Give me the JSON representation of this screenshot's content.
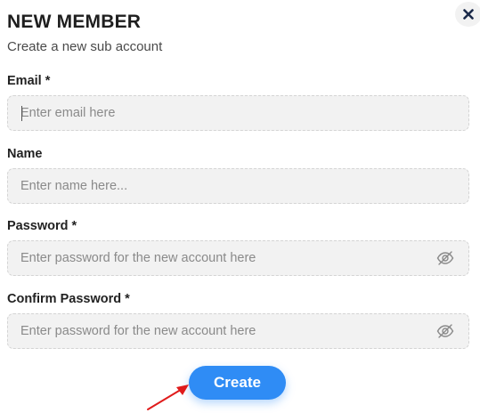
{
  "dialog": {
    "title": "NEW MEMBER",
    "subtitle": "Create a new sub account",
    "close_icon": "close-icon"
  },
  "form": {
    "email": {
      "label": "Email *",
      "placeholder": "Enter email here",
      "value": ""
    },
    "name": {
      "label": "Name",
      "placeholder": "Enter name here...",
      "value": ""
    },
    "password": {
      "label": "Password *",
      "placeholder": "Enter password for the new account here",
      "value": "",
      "toggle_icon": "eye-slash-icon"
    },
    "confirm_password": {
      "label": "Confirm Password *",
      "placeholder": "Enter password for the new account here",
      "value": "",
      "toggle_icon": "eye-slash-icon"
    }
  },
  "actions": {
    "create_label": "Create"
  },
  "annotation": {
    "arrow_icon": "red-arrow-icon"
  },
  "colors": {
    "primary": "#2f8cf5",
    "field_bg": "#f2f2f2",
    "annotation": "#e01b1b"
  }
}
